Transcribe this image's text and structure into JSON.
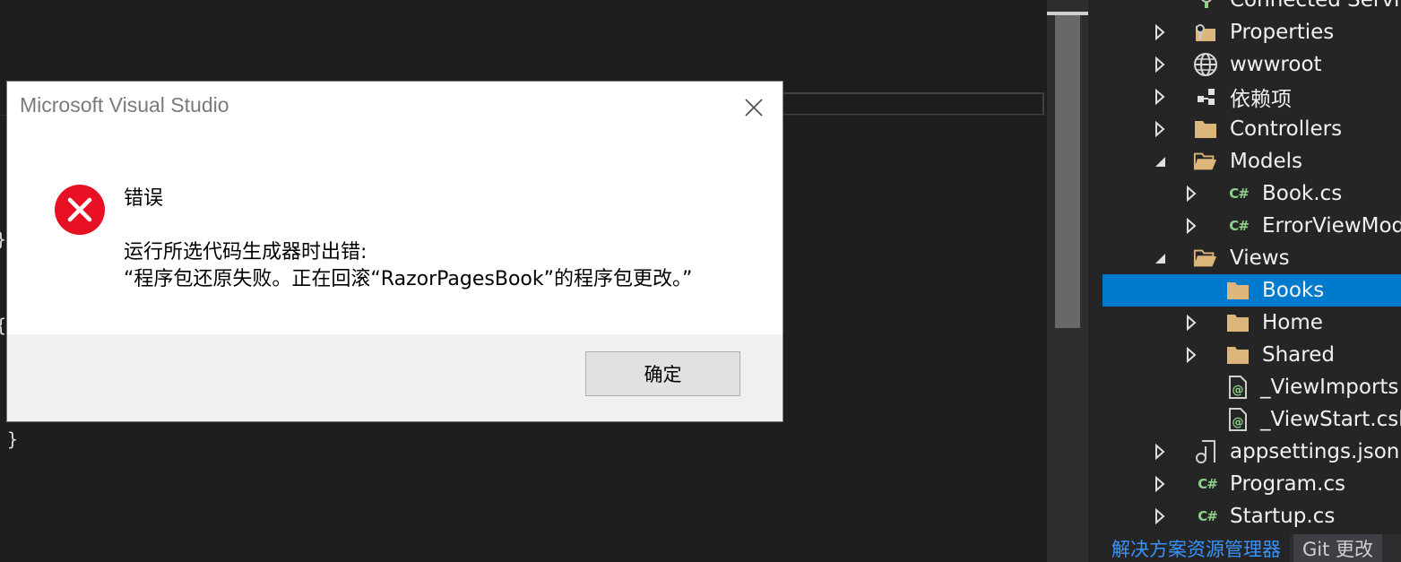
{
  "dialog": {
    "title": "Microsoft Visual Studio",
    "heading": "错误",
    "message_line1": "运行所选代码生成器时出错:",
    "message_line2": "“程序包还原失败。正在回滚“RazorPagesBook”的程序包更改。”",
    "ok_label": "确定",
    "icon": "error-icon"
  },
  "editor": {
    "brace_open": "{",
    "brace_close": "}"
  },
  "solution_explorer": {
    "items": [
      {
        "label": "Connected Servi",
        "icon": "connected-services-icon",
        "toggle": "none"
      },
      {
        "label": "Properties",
        "icon": "properties-folder-icon",
        "toggle": "collapsed"
      },
      {
        "label": "wwwroot",
        "icon": "globe-icon",
        "toggle": "collapsed"
      },
      {
        "label": "依赖项",
        "icon": "dependencies-icon",
        "toggle": "collapsed"
      },
      {
        "label": "Controllers",
        "icon": "folder-icon",
        "toggle": "collapsed"
      },
      {
        "label": "Models",
        "icon": "folder-open-icon",
        "toggle": "expanded"
      },
      {
        "label": "Book.cs",
        "icon": "csharp-file-icon",
        "toggle": "collapsed"
      },
      {
        "label": "ErrorViewMod",
        "icon": "csharp-file-icon",
        "toggle": "collapsed"
      },
      {
        "label": "Views",
        "icon": "folder-open-icon",
        "toggle": "expanded"
      },
      {
        "label": "Books",
        "icon": "folder-icon",
        "toggle": "none",
        "selected": true
      },
      {
        "label": "Home",
        "icon": "folder-icon",
        "toggle": "collapsed"
      },
      {
        "label": "Shared",
        "icon": "folder-icon",
        "toggle": "collapsed"
      },
      {
        "label": "_ViewImports",
        "icon": "razor-file-icon",
        "toggle": "none"
      },
      {
        "label": "_ViewStart.csh",
        "icon": "razor-file-icon",
        "toggle": "none"
      },
      {
        "label": "appsettings.json",
        "icon": "json-file-icon",
        "toggle": "collapsed"
      },
      {
        "label": "Program.cs",
        "icon": "csharp-file-icon",
        "toggle": "collapsed"
      },
      {
        "label": "Startup.cs",
        "icon": "csharp-file-icon",
        "toggle": "collapsed"
      }
    ]
  },
  "bottom_tabs": [
    {
      "label": "解决方案资源管理器",
      "active": true
    },
    {
      "label": "Git 更改",
      "active": false
    }
  ],
  "colors": {
    "selection": "#007acc",
    "folder": "#dcb67a",
    "csharp": "#8dd28a",
    "error_red": "#e81123"
  }
}
